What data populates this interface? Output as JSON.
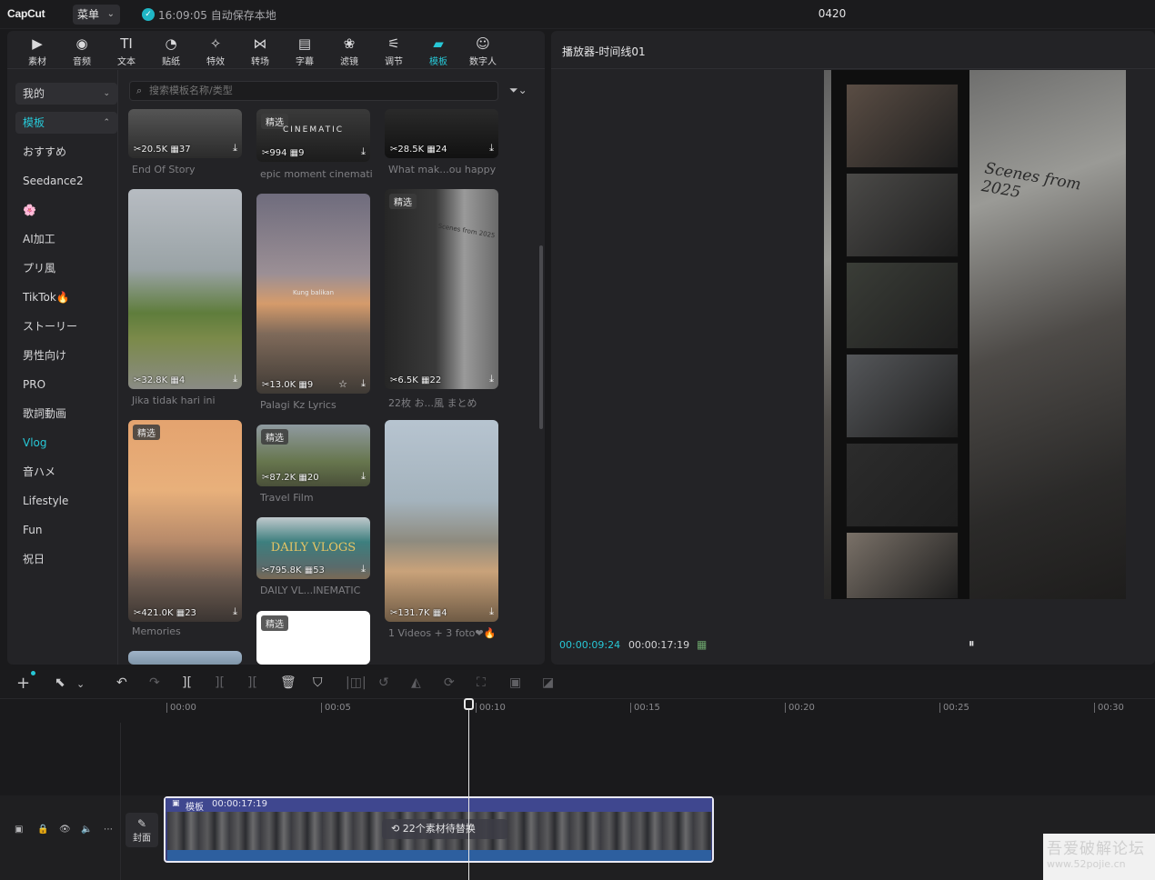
{
  "topbar": {
    "logo": "CapCut",
    "menu_label": "菜单",
    "save_status": "16:09:05 自动保存本地",
    "project_name": "0420"
  },
  "toolbar": [
    {
      "label": "素材",
      "icon": "media-icon",
      "glyph": "▶"
    },
    {
      "label": "音频",
      "icon": "audio-icon",
      "glyph": "◉"
    },
    {
      "label": "文本",
      "icon": "text-icon",
      "glyph": "TI"
    },
    {
      "label": "贴纸",
      "icon": "sticker-icon",
      "glyph": "◔"
    },
    {
      "label": "特效",
      "icon": "effects-icon",
      "glyph": "✧"
    },
    {
      "label": "转场",
      "icon": "transition-icon",
      "glyph": "⋈"
    },
    {
      "label": "字幕",
      "icon": "captions-icon",
      "glyph": "▤"
    },
    {
      "label": "滤镜",
      "icon": "filter-icon",
      "glyph": "❀"
    },
    {
      "label": "调节",
      "icon": "adjust-icon",
      "glyph": "⚟"
    },
    {
      "label": "模板",
      "icon": "template-icon",
      "glyph": "▰"
    },
    {
      "label": "数字人",
      "icon": "avatar-icon",
      "glyph": "☺"
    }
  ],
  "sidebar": [
    {
      "label": "我的",
      "chev": "⌄"
    },
    {
      "label": "模板",
      "chev": "⌃"
    },
    {
      "label": "おすすめ"
    },
    {
      "label": "Seedance2"
    },
    {
      "label": "🌸"
    },
    {
      "label": "AI加工"
    },
    {
      "label": "プリ風"
    },
    {
      "label": "TikTok🔥"
    },
    {
      "label": "ストーリー"
    },
    {
      "label": "男性向け"
    },
    {
      "label": "PRO"
    },
    {
      "label": "歌詞動画"
    },
    {
      "label": "Vlog"
    },
    {
      "label": "音ハメ"
    },
    {
      "label": "Lifestyle"
    },
    {
      "label": "Fun"
    },
    {
      "label": "祝日"
    }
  ],
  "search": {
    "placeholder": "搜索模板名称/类型"
  },
  "badge_text": "精选",
  "cards": [
    {
      "stats": "✂20.5K ▦37",
      "title": "End Of Story"
    },
    {
      "stats": "✂994 ▦9",
      "title": "epic moment cinemati",
      "overlay": "CINEMATIC"
    },
    {
      "stats": "✂28.5K ▦24",
      "title": "What mak...ou happy"
    },
    {
      "stats": "✂32.8K ▦4",
      "title": "Jika tidak hari ini"
    },
    {
      "stats": "✂13.0K ▦9",
      "title": "Palagi Kz Lyrics",
      "overlay": "Kung balikan"
    },
    {
      "stats": "✂6.5K ▦22",
      "title": "22枚 お...風 まとめ",
      "overlay": "Scenes from 2025"
    },
    {
      "stats": "✂421.0K ▦23",
      "title": "Memories"
    },
    {
      "stats": "✂87.2K ▦20",
      "title": "Travel Film"
    },
    {
      "stats": "✂131.7K ▦4",
      "title": "1 Videos + 3 foto❤🔥"
    },
    {
      "stats": "✂795.8K ▦53",
      "title": "DAILY VL...INEMATIC",
      "overlay": "DAILY VLOGS"
    },
    {
      "stats": "",
      "title": ""
    },
    {
      "stats": "",
      "title": ""
    }
  ],
  "player": {
    "title": "播放器-时间线01",
    "preview_text": "Scenes from 2025",
    "time_current": "00:00:09:24",
    "time_total": "00:00:17:19"
  },
  "ruler": [
    "00:00",
    "00:05",
    "00:10",
    "00:15",
    "00:20",
    "00:25",
    "00:30"
  ],
  "track": {
    "cover_label": "封面",
    "clip_label": "模板",
    "clip_duration": "00:00:17:19",
    "replace_text": "22个素材待替换"
  },
  "watermark": {
    "title": "吾爱破解论坛",
    "url": "www.52pojie.cn"
  }
}
